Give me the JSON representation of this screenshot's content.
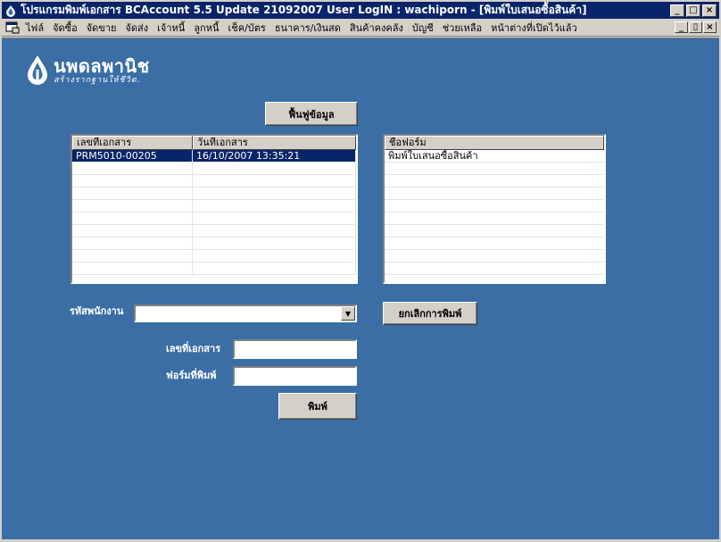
{
  "window": {
    "title": "โปรแกรมพิมพ์เอกสาร BCAccount 5.5 Update 21092007 User LogIN : wachiporn - [พิมพ์ใบเสนอซื้อสินค้า]",
    "minimize": "_",
    "maximize": "□",
    "close": "×",
    "restore": "▯"
  },
  "menu": {
    "items": [
      "ไฟล์",
      "จัดซื้อ",
      "จัดขาย",
      "จัดส่ง",
      "เจ้าหนี้",
      "ลูกหนี้",
      "เช็ค/บัตร",
      "ธนาคาร/เงินสด",
      "สินค้าคงคลัง",
      "บัญชี",
      "ช่วยเหลือ",
      "หน้าต่างที่เปิดไว้แล้ว"
    ]
  },
  "logo": {
    "name": "นพดลพานิช",
    "slogan": "สร้างรากฐานให้ชีวิต.",
    "color": "#ffffff"
  },
  "restore_button": "ฟื้นฟูข้อมูล",
  "documents": {
    "columns": [
      "เลขที่เอกสาร",
      "วันที่เอกสาร"
    ],
    "rows": [
      [
        "PRM5010-00205",
        "16/10/2007 13:35:21"
      ]
    ]
  },
  "forms": {
    "columns": [
      "ชื่อฟอร์ม"
    ],
    "rows": [
      [
        "พิมพ์ใบเสนอซื้อสินค้า"
      ]
    ]
  },
  "employee": {
    "label": "รหัสพนักงาน",
    "value": ""
  },
  "cancel_print_button": "ยกเลิกการพิมพ์",
  "doc_no": {
    "label": "เลขที่เอกสาร",
    "value": ""
  },
  "print_form": {
    "label": "ฟอร์มที่พิมพ์",
    "value": ""
  },
  "print_button": "พิมพ์",
  "colors": {
    "title_bar": "#0a246a",
    "client_bg": "#3a6ea5",
    "selection": "#0a246a"
  }
}
